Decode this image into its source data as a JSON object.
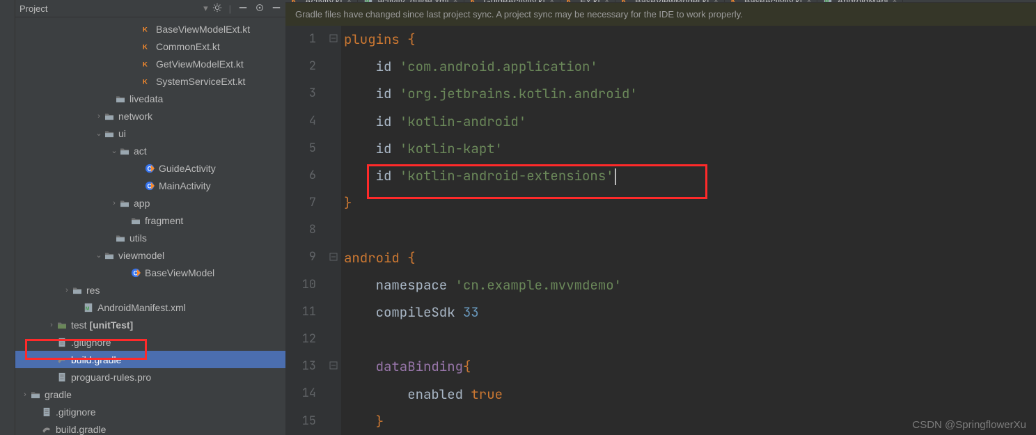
{
  "sidebar": {
    "project_label": "Project"
  },
  "tree_header": {
    "title": "Project"
  },
  "tree": [
    {
      "indent": 168,
      "arrow": "",
      "icon": "kt",
      "label": "BaseViewModelExt.kt"
    },
    {
      "indent": 168,
      "arrow": "",
      "icon": "kt",
      "label": "CommonExt.kt"
    },
    {
      "indent": 168,
      "arrow": "",
      "icon": "kt",
      "label": "GetViewModelExt.kt"
    },
    {
      "indent": 168,
      "arrow": "",
      "icon": "kt",
      "label": "SystemServiceExt.kt"
    },
    {
      "indent": 130,
      "arrow": "",
      "icon": "folder",
      "label": "livedata"
    },
    {
      "indent": 114,
      "arrow": "›",
      "icon": "folder",
      "label": "network"
    },
    {
      "indent": 114,
      "arrow": "⌄",
      "icon": "folder",
      "label": "ui"
    },
    {
      "indent": 136,
      "arrow": "⌄",
      "icon": "folder",
      "label": "act"
    },
    {
      "indent": 172,
      "arrow": "",
      "icon": "kotlin-class",
      "label": "GuideActivity"
    },
    {
      "indent": 172,
      "arrow": "",
      "icon": "kotlin-class",
      "label": "MainActivity"
    },
    {
      "indent": 136,
      "arrow": "›",
      "icon": "folder",
      "label": "app"
    },
    {
      "indent": 152,
      "arrow": "",
      "icon": "folder",
      "label": "fragment"
    },
    {
      "indent": 130,
      "arrow": "",
      "icon": "folder",
      "label": "utils"
    },
    {
      "indent": 114,
      "arrow": "⌄",
      "icon": "folder",
      "label": "viewmodel"
    },
    {
      "indent": 152,
      "arrow": "",
      "icon": "kotlin-class",
      "label": "BaseViewModel"
    },
    {
      "indent": 68,
      "arrow": "›",
      "icon": "folder-res",
      "label": "res"
    },
    {
      "indent": 84,
      "arrow": "",
      "icon": "xml",
      "label": "AndroidManifest.xml"
    },
    {
      "indent": 46,
      "arrow": "›",
      "icon": "folder-test",
      "label": "test [unitTest]",
      "test": true
    },
    {
      "indent": 46,
      "arrow": "",
      "icon": "file",
      "label": ".gitignore"
    },
    {
      "indent": 46,
      "arrow": "",
      "icon": "gradle",
      "label": "build.gradle",
      "selected": true
    },
    {
      "indent": 46,
      "arrow": "",
      "icon": "file",
      "label": "proguard-rules.pro"
    },
    {
      "indent": 8,
      "arrow": "›",
      "icon": "folder",
      "label": "gradle"
    },
    {
      "indent": 24,
      "arrow": "",
      "icon": "file",
      "label": ".gitignore"
    },
    {
      "indent": 24,
      "arrow": "",
      "icon": "gradle",
      "label": "build.gradle"
    }
  ],
  "tabs": [
    {
      "icon": "kt",
      "label": "Activity.kt"
    },
    {
      "icon": "xml",
      "label": "activity_guide.xml"
    },
    {
      "icon": "kt",
      "label": "GuideActivity.kt"
    },
    {
      "icon": "kt",
      "label": "Ex.kt"
    },
    {
      "icon": "kt",
      "label": "BaseViewModel.kt"
    },
    {
      "icon": "kt",
      "label": "BaseActivity.kt"
    },
    {
      "icon": "xml",
      "label": "AndroidMani"
    }
  ],
  "notification": "Gradle files have changed since last project sync. A project sync may be necessary for the IDE to work properly.",
  "code_lines": [
    {
      "n": 1,
      "html": "<span class='kw'>plugins</span> <span class='kw'>{</span>"
    },
    {
      "n": 2,
      "html": "    id <span class='str'>'com.android.application'</span>"
    },
    {
      "n": 3,
      "html": "    id <span class='str'>'org.jetbrains.kotlin.android'</span>"
    },
    {
      "n": 4,
      "html": "    id <span class='str'>'kotlin-android'</span>"
    },
    {
      "n": 5,
      "html": "    id <span class='str'>'kotlin-kapt'</span>"
    },
    {
      "n": 6,
      "html": "    id <span class='str'>'kotlin-android-extensions'</span><span class='caret'></span>"
    },
    {
      "n": 7,
      "html": "<span class='kw'>}</span>"
    },
    {
      "n": 8,
      "html": ""
    },
    {
      "n": 9,
      "html": "<span class='kw'>android</span> <span class='kw'>{</span>"
    },
    {
      "n": 10,
      "html": "    namespace <span class='str'>'cn.example.mvvmdemo'</span>"
    },
    {
      "n": 11,
      "html": "    compileSdk <span class='num'>33</span>"
    },
    {
      "n": 12,
      "html": ""
    },
    {
      "n": 13,
      "html": "    <span class='prop'>dataBinding</span><span class='kw'>{</span>"
    },
    {
      "n": 14,
      "html": "        enabled <span class='kw'>true</span>"
    },
    {
      "n": 15,
      "html": "    <span class='kw'>}</span>"
    }
  ],
  "watermark": "CSDN @SpringflowerXu"
}
